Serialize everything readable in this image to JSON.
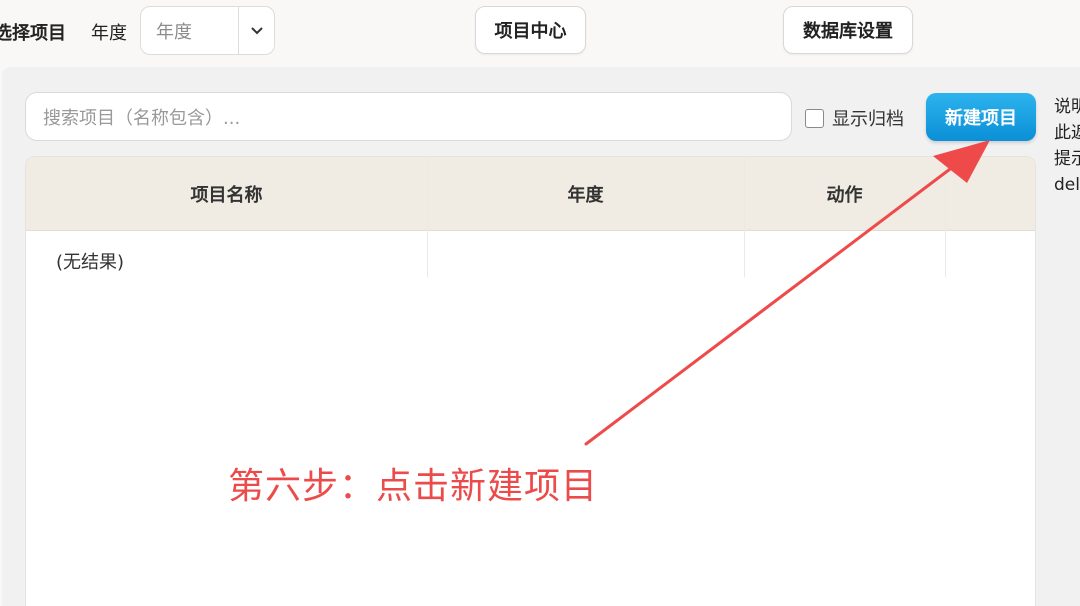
{
  "header": {
    "select_project_label": "选择项目",
    "year_label": "年度",
    "year_select_value": "年度",
    "project_center_button": "项目中心",
    "database_settings_button": "数据库设置"
  },
  "toolbar": {
    "search_placeholder": "搜索项目（名称包含）...",
    "show_archived_label": "显示归档",
    "new_project_button": "新建项目"
  },
  "side_note": {
    "line1": "说明",
    "line2": "此返",
    "line3": "提示",
    "line4": "del"
  },
  "table": {
    "columns": [
      "项目名称",
      "年度",
      "动作"
    ],
    "empty_text": "(无结果)"
  },
  "annotation": {
    "text": "第六步：点击新建项目",
    "color": "#ec4b4b"
  },
  "colors": {
    "accent": "#1aa3e6",
    "header_bg": "#f0ebe3"
  }
}
